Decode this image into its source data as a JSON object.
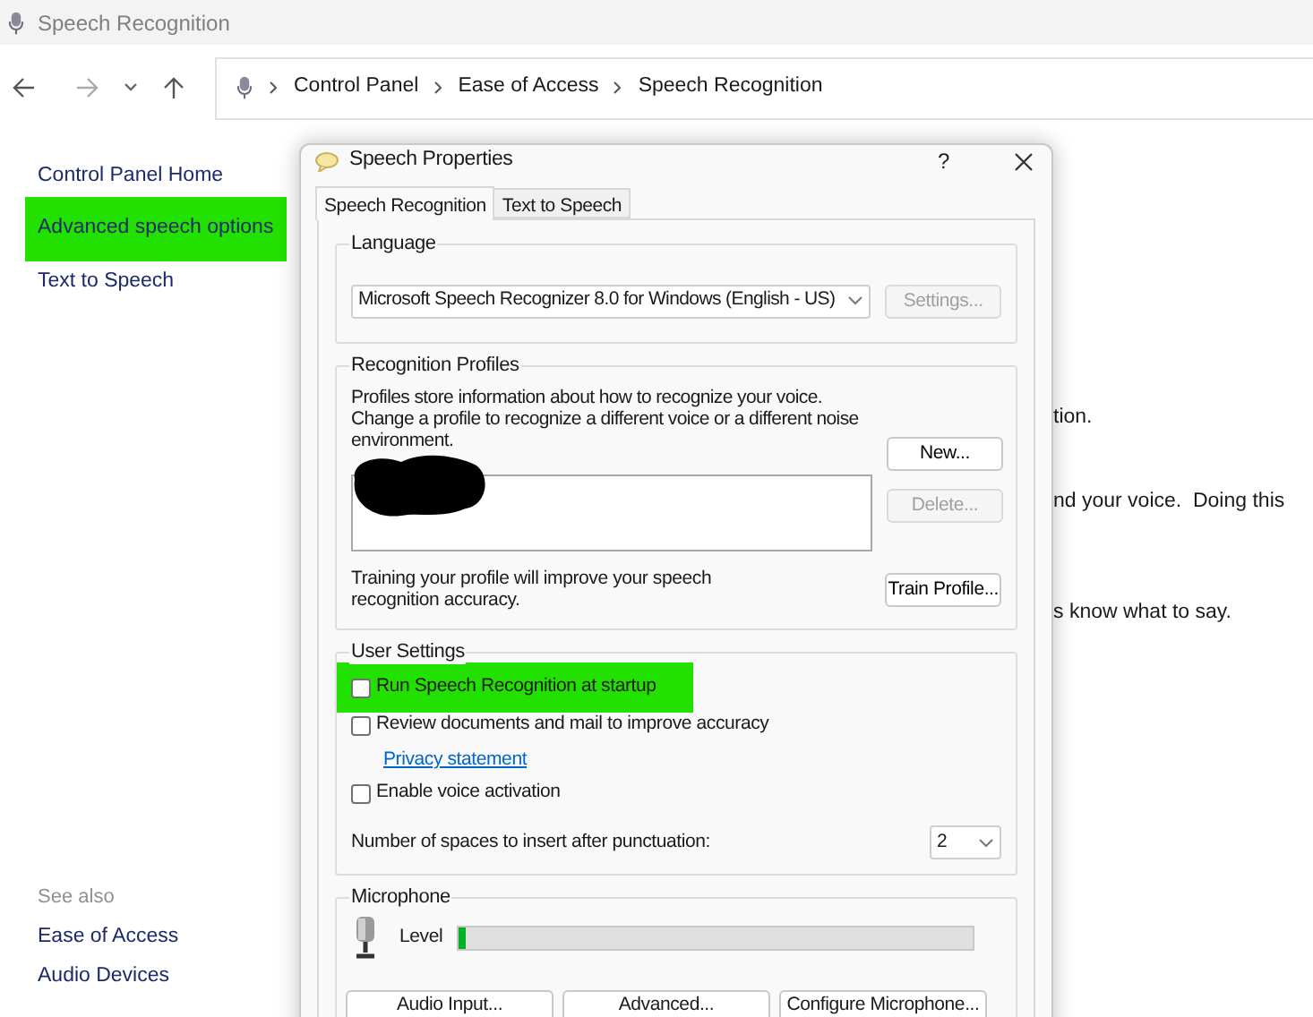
{
  "window": {
    "title": "Speech Recognition"
  },
  "nav": {
    "breadcrumb": [
      {
        "label": "Control Panel"
      },
      {
        "label": "Ease of Access"
      },
      {
        "label": "Speech Recognition"
      }
    ]
  },
  "sidebar": {
    "items": [
      {
        "label": "Control Panel Home",
        "highlighted": false
      },
      {
        "label": "Advanced speech options",
        "highlighted": true
      },
      {
        "label": "Text to Speech",
        "highlighted": false
      }
    ],
    "see_also": {
      "heading": "See also",
      "items": [
        {
          "label": "Ease of Access"
        },
        {
          "label": "Audio Devices"
        }
      ]
    }
  },
  "background_text": [
    "tion.",
    "nd your voice.  Doing this",
    "s know what to say."
  ],
  "dialog": {
    "title": "Speech Properties",
    "help": "?",
    "tabs": [
      {
        "label": "Speech Recognition",
        "selected": true
      },
      {
        "label": "Text to Speech",
        "selected": false
      }
    ],
    "language": {
      "heading": "Language",
      "value": "Microsoft Speech Recognizer 8.0 for Windows (English - US)",
      "settings_button": {
        "label": "Settings...",
        "disabled": true
      }
    },
    "profiles": {
      "heading": "Recognition Profiles",
      "description": "Profiles store information about how to recognize your voice. Change a profile to recognize a different voice or a different noise environment.",
      "new_button": {
        "label": "New...",
        "disabled": false
      },
      "delete_button": {
        "label": "Delete...",
        "disabled": true
      },
      "redacted": true,
      "training_text": "Training your profile will improve your speech recognition accuracy.",
      "train_button": {
        "label": "Train Profile...",
        "disabled": false
      }
    },
    "user_settings": {
      "heading": "User Settings",
      "items": [
        {
          "kind": "checkbox",
          "label": "Run Speech Recognition at startup",
          "checked": false,
          "highlighted": true
        },
        {
          "kind": "checkbox",
          "label": "Review documents and mail to improve accuracy",
          "checked": false,
          "highlighted": false
        },
        {
          "kind": "link",
          "label": "Privacy statement"
        },
        {
          "kind": "checkbox",
          "label": "Enable voice activation",
          "checked": false,
          "highlighted": false
        }
      ],
      "spaces_label": "Number of spaces to insert after punctuation:",
      "spaces_value": "2"
    },
    "microphone": {
      "heading": "Microphone",
      "level_label": "Level",
      "level": 0.012,
      "buttons": [
        {
          "label": "Audio Input..."
        },
        {
          "label": "Advanced..."
        },
        {
          "label": "Configure Microphone..."
        }
      ]
    }
  }
}
